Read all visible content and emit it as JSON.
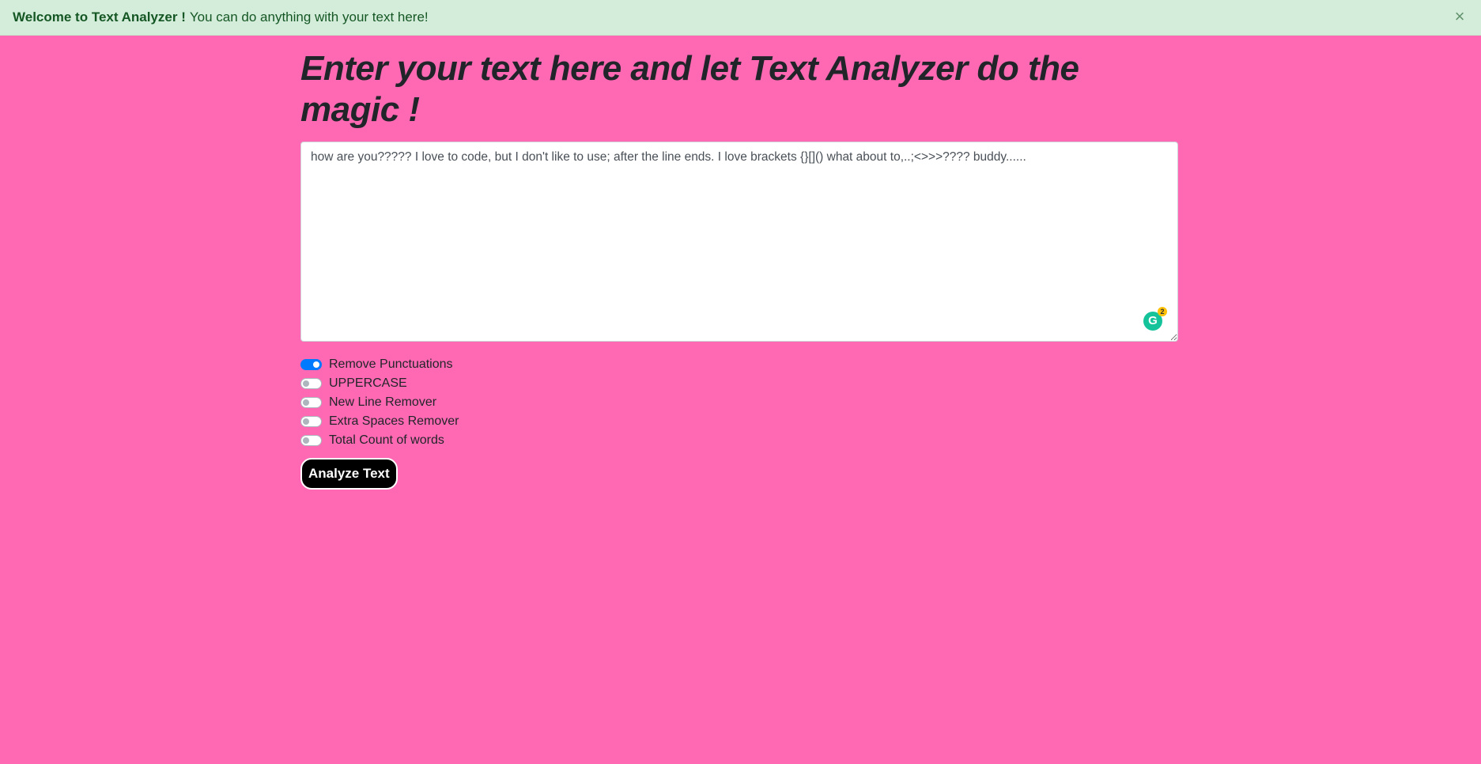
{
  "alert": {
    "strong": "Welcome to Text Analyzer !",
    "message": "You can do anything with your text here!",
    "close": "×"
  },
  "main": {
    "heading": "Enter your text here and let Text Analyzer do the magic !",
    "textarea_value": "how are you????? I love to code, but I don't like to use; after the line ends. I love brackets {}[]() what about to,..;<>>>???? buddy......",
    "grammarly_icon": "G",
    "grammarly_count": "2"
  },
  "switches": [
    {
      "label": "Remove Punctuations",
      "checked": true
    },
    {
      "label": "UPPERCASE",
      "checked": false
    },
    {
      "label": "New Line Remover",
      "checked": false
    },
    {
      "label": "Extra Spaces Remover",
      "checked": false
    },
    {
      "label": "Total Count of words",
      "checked": false
    }
  ],
  "button": {
    "label": "Analyze Text"
  },
  "colors": {
    "background": "#ff69b4",
    "alert_bg": "#d4edda",
    "alert_text": "#155724",
    "toggle_on": "#007bff",
    "button_bg": "#000000"
  }
}
